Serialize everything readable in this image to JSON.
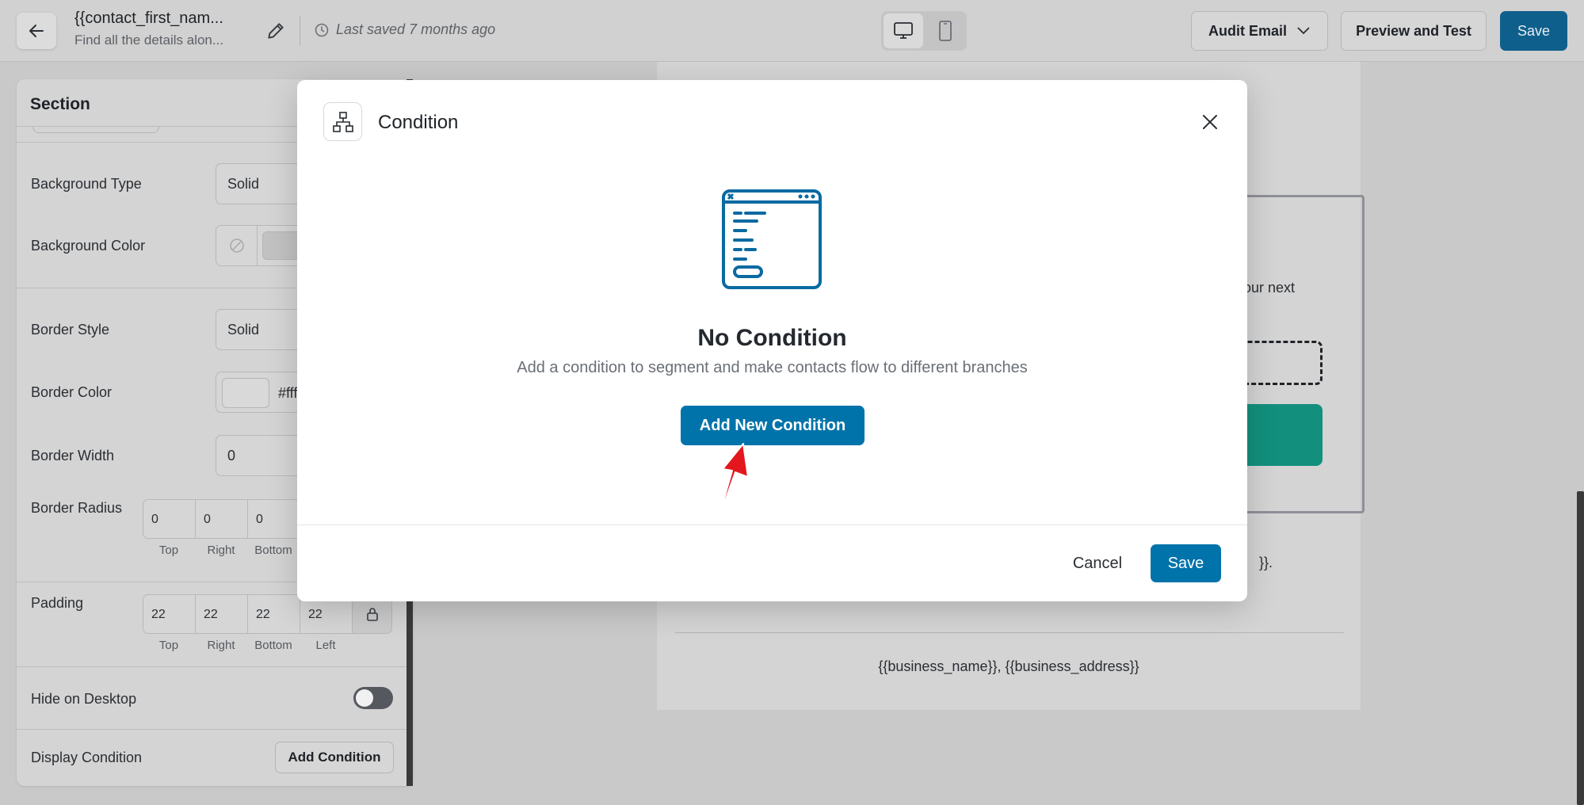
{
  "header": {
    "title": "{{contact_first_nam...",
    "subtitle": "Find all the details alon...",
    "last_saved": "Last saved 7 months ago",
    "audit_label": "Audit Email",
    "preview_label": "Preview and Test",
    "save_label": "Save"
  },
  "panel": {
    "title": "Section",
    "background_type_label": "Background Type",
    "background_type_value": "Solid",
    "background_color_label": "Background Color",
    "border_style_label": "Border Style",
    "border_style_value": "Solid",
    "border_color_label": "Border Color",
    "border_color_value": "#fff",
    "border_width_label": "Border Width",
    "border_width_value": "0",
    "border_radius_label": "Border Radius",
    "border_radius_values": [
      "0",
      "0",
      "0"
    ],
    "padding_label": "Padding",
    "padding_values": [
      "22",
      "22",
      "22",
      "22"
    ],
    "side_labels": [
      "Top",
      "Right",
      "Bottom",
      "Left"
    ],
    "hide_desktop_label": "Hide on Desktop",
    "hide_desktop_on": false,
    "display_condition_label": "Display Condition",
    "add_condition_label": "Add Condition"
  },
  "email_preview": {
    "text_fragment": "our next",
    "text_fragment_2": "}}.",
    "footer": "{{business_name}}, {{business_address}}"
  },
  "modal": {
    "title": "Condition",
    "empty_title": "No Condition",
    "empty_desc": "Add a condition to segment and make contacts flow to different branches",
    "add_button": "Add New Condition",
    "cancel_label": "Cancel",
    "save_label": "Save"
  },
  "colors": {
    "primary": "#0073aa",
    "overlay": "#c9c9c9",
    "teal_button": "#13907d",
    "arrow": "#e3161e"
  },
  "icons": [
    "back-arrow-icon",
    "pencil-icon",
    "clock-icon",
    "desktop-icon",
    "mobile-icon",
    "chevron-down-icon",
    "no-color-icon",
    "lock-icon",
    "flow-tree-icon",
    "close-icon",
    "code-window-illustration"
  ]
}
